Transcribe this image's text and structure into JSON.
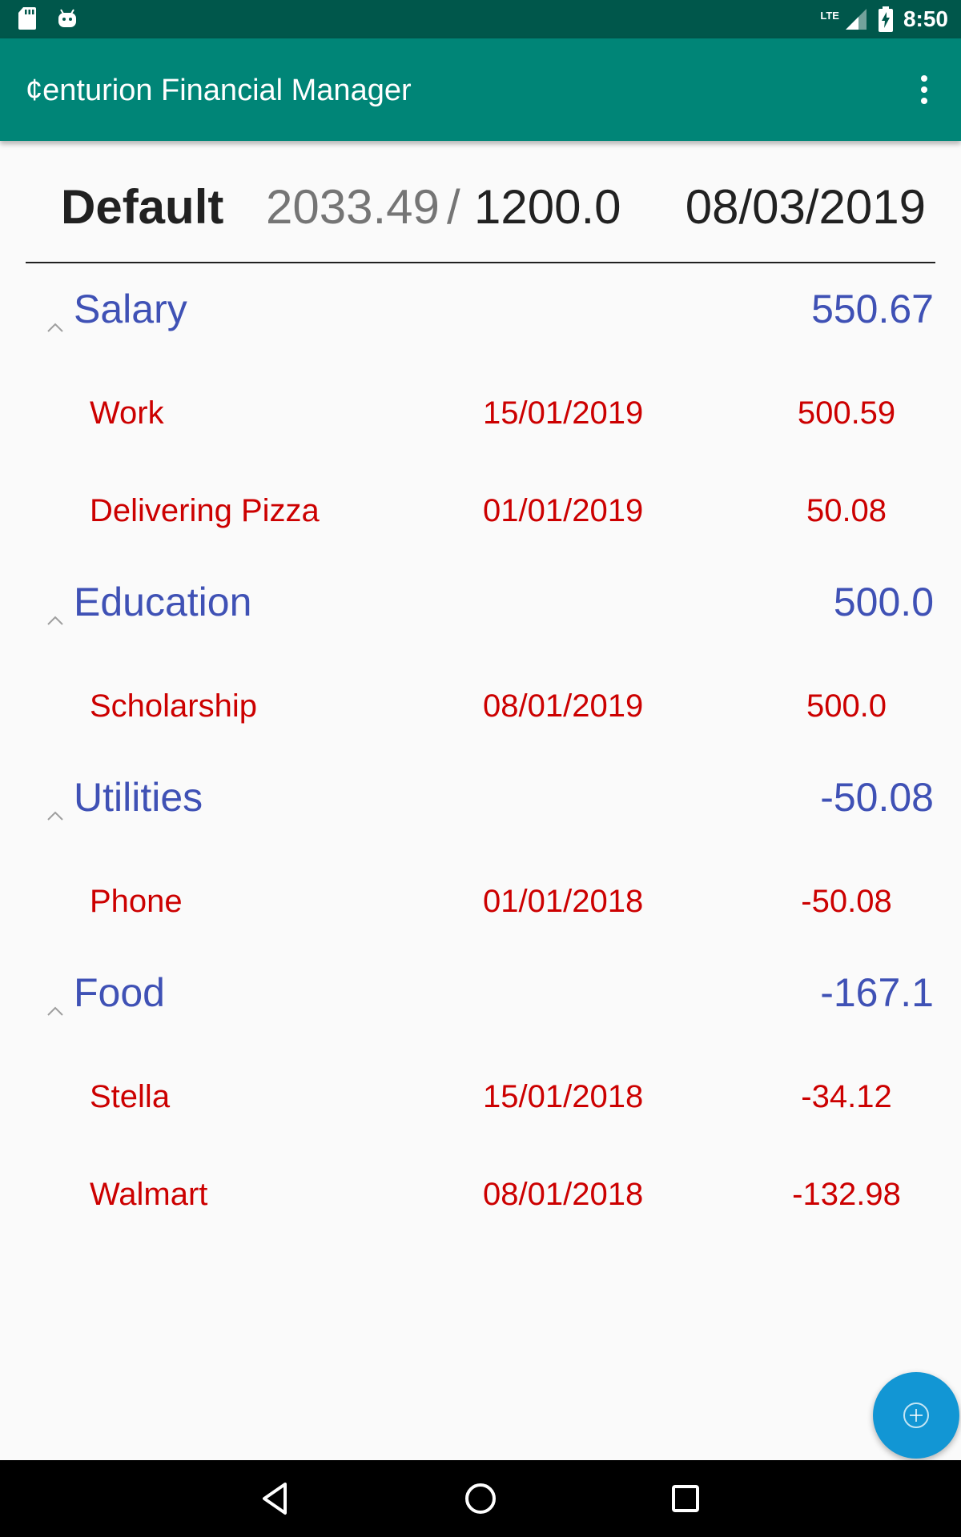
{
  "status_bar": {
    "network": "LTE",
    "time": "8:50",
    "icons": [
      "sd-card-icon",
      "android-icon",
      "signal-icon",
      "battery-charging-icon"
    ]
  },
  "app_bar": {
    "title": "¢enturion Financial Manager",
    "menu_icon": "more-vert-icon"
  },
  "summary": {
    "account": "Default",
    "balance": "2033.49",
    "separator": "/",
    "budget": "1200.0",
    "date": "08/03/2019"
  },
  "categories": [
    {
      "name": "Salary",
      "total": "550.67",
      "items": [
        {
          "name": "Work",
          "date": "15/01/2019",
          "amount": "500.59"
        },
        {
          "name": "Delivering Pizza",
          "date": "01/01/2019",
          "amount": "50.08"
        }
      ]
    },
    {
      "name": "Education",
      "total": "500.0",
      "items": [
        {
          "name": "Scholarship",
          "date": "08/01/2019",
          "amount": "500.0"
        }
      ]
    },
    {
      "name": "Utilities",
      "total": "-50.08",
      "items": [
        {
          "name": "Phone",
          "date": "01/01/2018",
          "amount": "-50.08"
        }
      ]
    },
    {
      "name": "Food",
      "total": "-167.1",
      "items": [
        {
          "name": "Stella",
          "date": "15/01/2018",
          "amount": "-34.12"
        },
        {
          "name": "Walmart",
          "date": "08/01/2018",
          "amount": "-132.98"
        }
      ]
    }
  ],
  "fab": {
    "icon": "add-circle-icon"
  },
  "nav_bar": {
    "icons": [
      "back-icon",
      "home-icon",
      "recents-icon"
    ]
  },
  "colors": {
    "status_bar": "#00574b",
    "app_bar": "#008577",
    "category_text": "#3f51b5",
    "item_text": "#cc0000",
    "fab": "#1296d4"
  }
}
